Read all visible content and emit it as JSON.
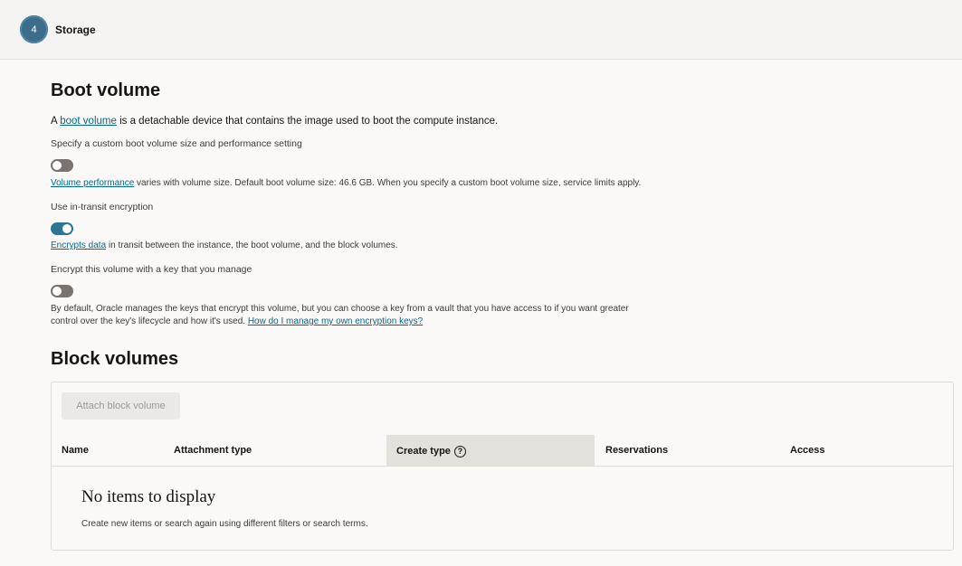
{
  "step": {
    "number": "4",
    "title": "Storage"
  },
  "boot_volume": {
    "heading": "Boot volume",
    "intro_prefix": "A ",
    "intro_link": "boot volume",
    "intro_suffix": " is a detachable device that contains the image used to boot the compute instance.",
    "custom_size_label": "Specify a custom boot volume size and performance setting",
    "custom_size_enabled": false,
    "perf_link": "Volume performance",
    "perf_text": " varies with volume size. Default boot volume size: 46.6 GB. When you specify a custom boot volume size, service limits apply.",
    "transit_label": "Use in-transit encryption",
    "transit_enabled": true,
    "transit_link": "Encrypts data",
    "transit_text": " in transit between the instance, the boot volume, and the block volumes.",
    "key_label": "Encrypt this volume with a key that you manage",
    "key_enabled": false,
    "key_text_line1": "By default, Oracle manages the keys that encrypt this volume, but you can choose a key from a vault that you have access to if you want greater",
    "key_text_line2": "control over the key's lifecycle and how it's used. ",
    "key_link": "How do I manage my own encryption keys?"
  },
  "block_volumes": {
    "heading": "Block volumes",
    "attach_button": "Attach block volume",
    "columns": [
      "Name",
      "Attachment type",
      "Create type",
      "Reservations",
      "Access"
    ],
    "empty_title": "No items to display",
    "empty_message": "Create new items or search again using different filters or search terms."
  },
  "icons": {
    "help": "question-circle-icon"
  },
  "colors": {
    "accent": "#00688c",
    "toggle_on": "#2b7696",
    "toggle_off": "#7a736e"
  }
}
